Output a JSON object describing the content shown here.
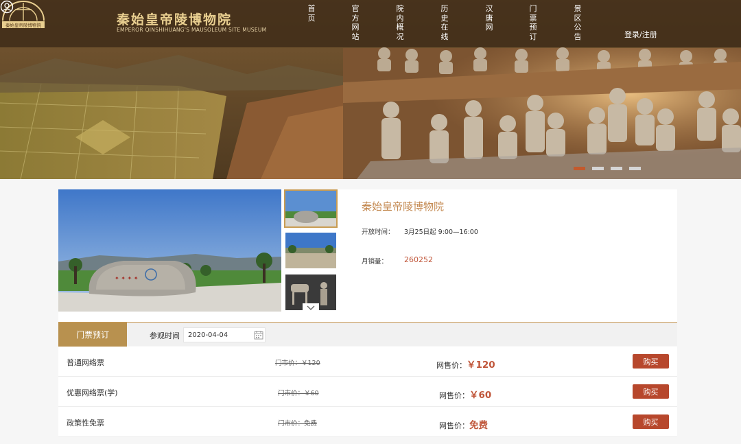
{
  "header": {
    "logo_badge": "秦始皇帝陵博物院",
    "title_cn": "秦始皇帝陵博物院",
    "title_en": "EMPEROR QINSHIHUANG'S MAUSOLEUM SITE MUSEUM",
    "nav": [
      "首页",
      "官方网站",
      "院内概况",
      "历史在线",
      "汉唐网",
      "门票预订",
      "景区公告"
    ],
    "login_label": "登录/注册"
  },
  "carousel": {
    "slide_count": 4,
    "active_index": 0
  },
  "product": {
    "title": "秦始皇帝陵博物院",
    "open_time_label": "开放时间：",
    "open_time_value": "3月25日起 9:00—16:00",
    "monthly_sales_label": "月销量：",
    "monthly_sales_value": "260252",
    "thumbnail_selected": 0
  },
  "booking": {
    "tab_label": "门票预订",
    "visit_label": "参观时间",
    "visit_date": "2020-04-04"
  },
  "tickets": [
    {
      "name": "普通网络票",
      "market_price": "门市价：￥120",
      "net_label": "网售价：",
      "net_price": "￥120",
      "buy_label": "购买"
    },
    {
      "name": "优惠网络票(学)",
      "market_price": "门市价：￥60",
      "net_label": "网售价：",
      "net_price": "￥60",
      "buy_label": "购买"
    },
    {
      "name": "政策性免票",
      "market_price": "门市价：免费",
      "net_label": "网售价：",
      "net_price": "免费",
      "buy_label": "购买"
    }
  ],
  "colors": {
    "accent_gold": "#b8914f",
    "price_red": "#c0563a",
    "buy_button": "#b7472c"
  }
}
